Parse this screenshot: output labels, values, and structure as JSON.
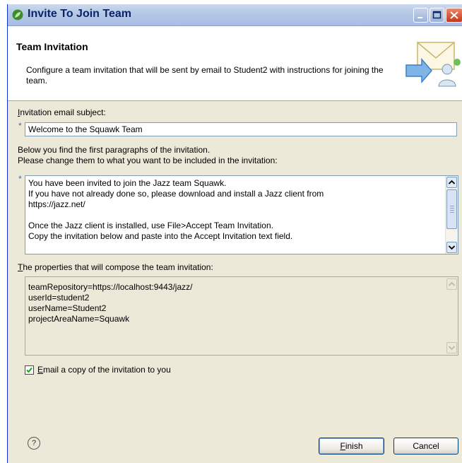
{
  "window": {
    "title": "Invite To Join Team"
  },
  "banner": {
    "title": "Team Invitation",
    "description": "Configure a team invitation that will be sent by email to Student2 with instructions for joining the team."
  },
  "subject": {
    "label_prefix": "I",
    "label_rest": "nvitation email subject:",
    "required_marker": "*",
    "value": "Welcome to the Squawk Team"
  },
  "body": {
    "instructions_line1": "Below you find the first paragraphs of the invitation.",
    "instructions_line2": "Please change them to what you want to be included in the invitation:",
    "required_marker": "*",
    "text": "You have been invited to join the Jazz team Squawk.\nIf you have not already done so, please download and install a Jazz client from\nhttps://jazz.net/\n\nOnce the Jazz client is installed, use File>Accept Team Invitation.\nCopy the invitation below and paste into the Accept Invitation text field."
  },
  "properties": {
    "label_prefix": "T",
    "label_rest": "he properties that will compose the team invitation:",
    "lines": [
      "teamRepository=https://localhost:9443/jazz/",
      "userId=student2",
      "userName=Student2",
      "projectAreaName=Squawk"
    ]
  },
  "email_copy": {
    "checked": true,
    "label_prefix": "E",
    "label_rest": "mail a copy of the invitation to you"
  },
  "buttons": {
    "help": "?",
    "finish_prefix": "F",
    "finish_rest": "inish",
    "cancel": "Cancel"
  },
  "colors": {
    "title_text": "#0a246a",
    "required": "#3d6bb3",
    "checkmark": "#21a121"
  }
}
